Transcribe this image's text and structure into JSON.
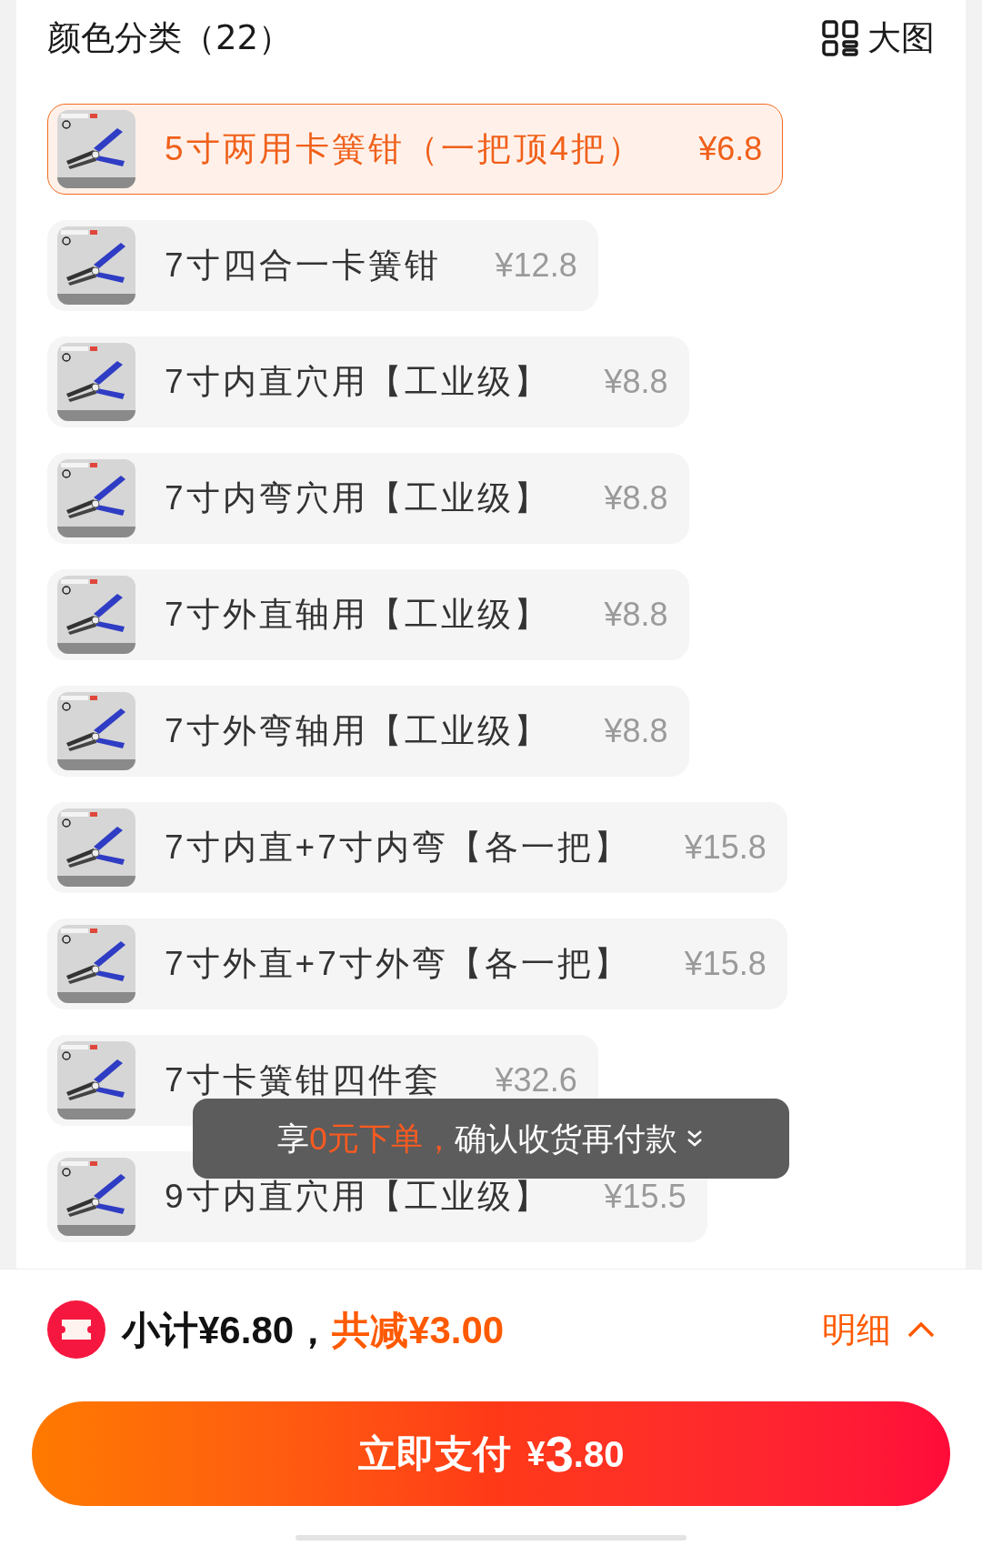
{
  "header": {
    "title": "颜色分类（22）",
    "view_toggle": "大图"
  },
  "items": [
    {
      "name": "5寸两用卡簧钳（一把顶4把）",
      "price": "¥6.8",
      "selected": true
    },
    {
      "name": "7寸四合一卡簧钳",
      "price": "¥12.8",
      "selected": false
    },
    {
      "name": "7寸内直穴用【工业级】",
      "price": "¥8.8",
      "selected": false
    },
    {
      "name": "7寸内弯穴用【工业级】",
      "price": "¥8.8",
      "selected": false
    },
    {
      "name": "7寸外直轴用【工业级】",
      "price": "¥8.8",
      "selected": false
    },
    {
      "name": "7寸外弯轴用【工业级】",
      "price": "¥8.8",
      "selected": false
    },
    {
      "name": "7寸内直+7寸内弯【各一把】",
      "price": "¥15.8",
      "selected": false
    },
    {
      "name": "7寸外直+7寸外弯【各一把】",
      "price": "¥15.8",
      "selected": false
    },
    {
      "name": "7寸卡簧钳四件套",
      "price": "¥32.6",
      "selected": false
    },
    {
      "name": "9寸内直穴用【工业级】",
      "price": "¥15.5",
      "selected": false
    }
  ],
  "toast": {
    "prefix": "享",
    "highlight": "0元下单，",
    "suffix": "确认收货再付款"
  },
  "summary": {
    "subtotal": "小计¥6.80，",
    "discount": "共减¥3.00",
    "detail": "明细"
  },
  "pay_button": {
    "label": "立即支付",
    "currency": "¥",
    "amount_major": "3",
    "amount_minor": ".80"
  }
}
